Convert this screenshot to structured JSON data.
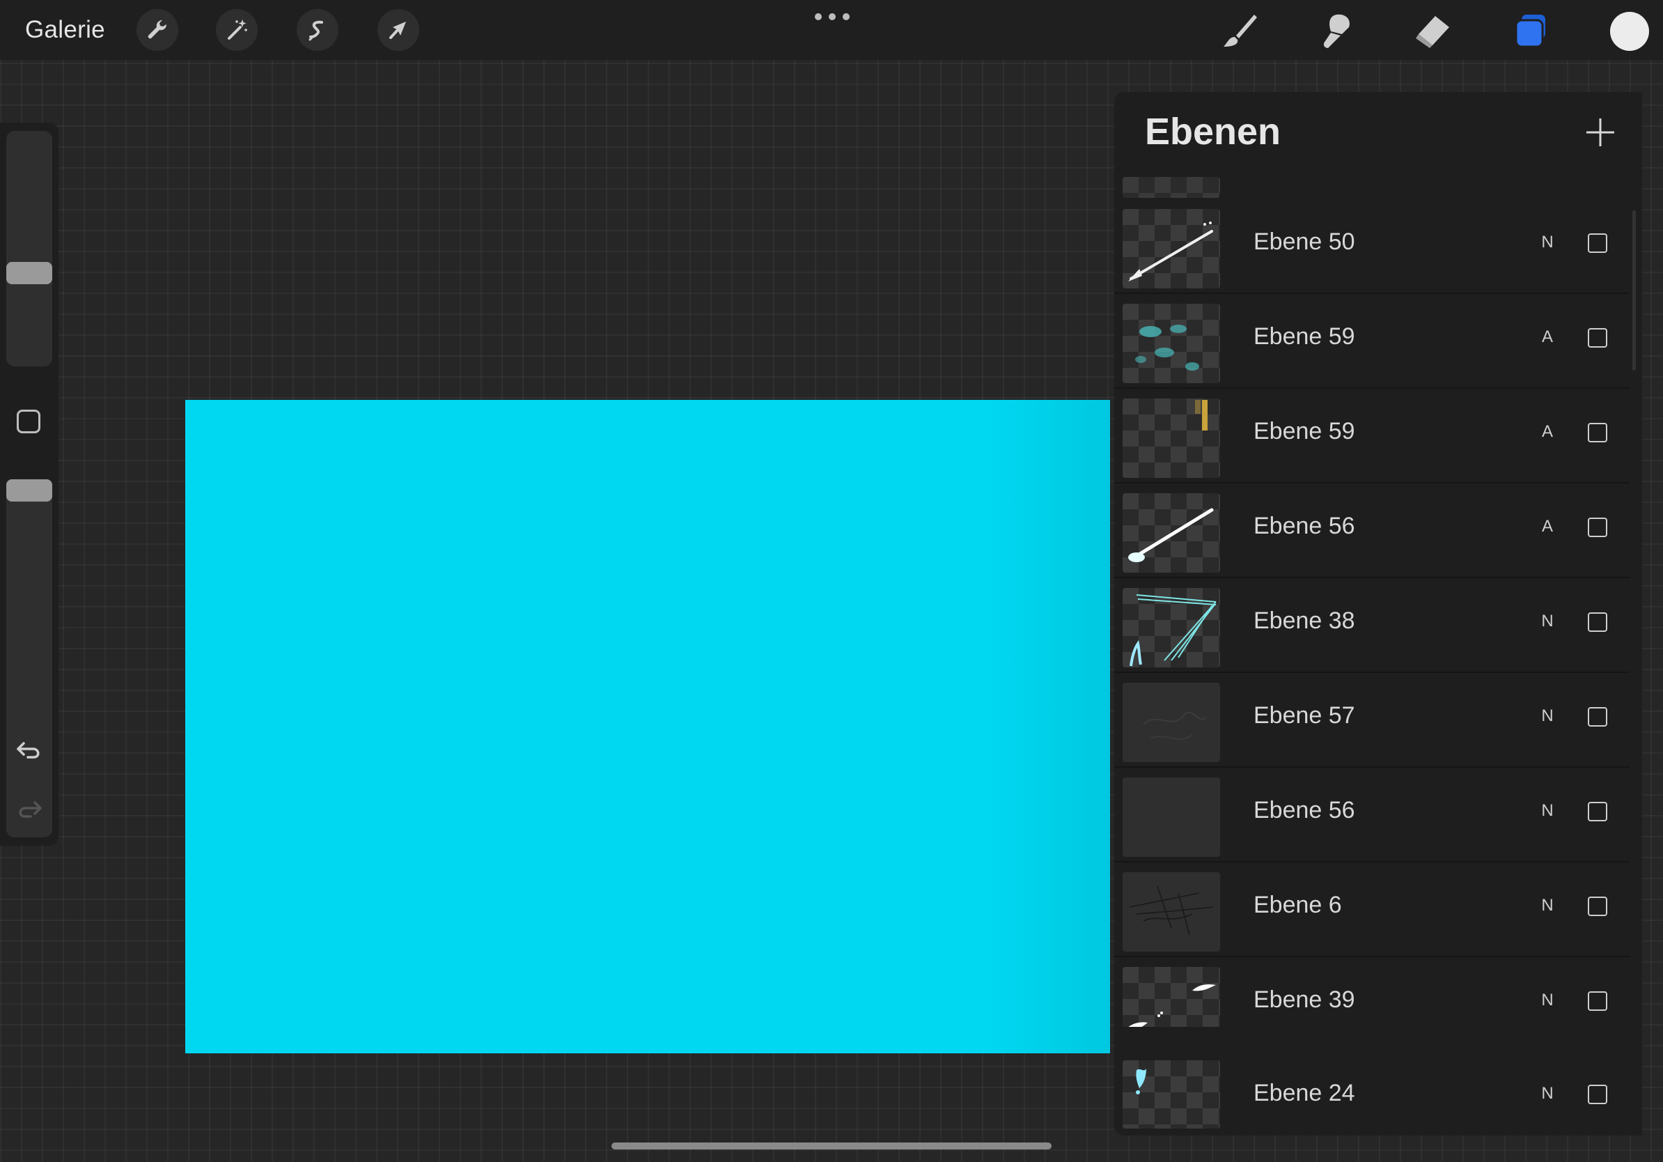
{
  "topbar": {
    "gallery_label": "Galerie",
    "tools_left": [
      "wrench-icon",
      "magic-wand-icon",
      "selection-icon",
      "transform-arrow-icon"
    ],
    "tools_right": [
      "brush-icon",
      "smudge-icon",
      "eraser-icon",
      "layers-icon"
    ],
    "active_tool": "layers-icon",
    "current_color": "#ececec"
  },
  "sidebar": {
    "brush_size_level": 0.6,
    "opacity_level": 0.78
  },
  "canvas": {
    "fill_color": "#00d8f2"
  },
  "layers": {
    "title": "Ebenen",
    "items": [
      {
        "name": "Ebene 50",
        "blend": "N",
        "thumb": "checker"
      },
      {
        "name": "Ebene 59",
        "blend": "A",
        "thumb": "checker"
      },
      {
        "name": "Ebene 59",
        "blend": "A",
        "thumb": "checker"
      },
      {
        "name": "Ebene 56",
        "blend": "A",
        "thumb": "checker"
      },
      {
        "name": "Ebene 38",
        "blend": "N",
        "thumb": "checker"
      },
      {
        "name": "Ebene 57",
        "blend": "N",
        "thumb": "solid"
      },
      {
        "name": "Ebene 56",
        "blend": "N",
        "thumb": "solid"
      },
      {
        "name": "Ebene 6",
        "blend": "N",
        "thumb": "solid"
      },
      {
        "name": "Ebene 39",
        "blend": "N",
        "thumb": "checker"
      },
      {
        "name": "Ebene 24",
        "blend": "N",
        "thumb": "checker"
      }
    ]
  }
}
